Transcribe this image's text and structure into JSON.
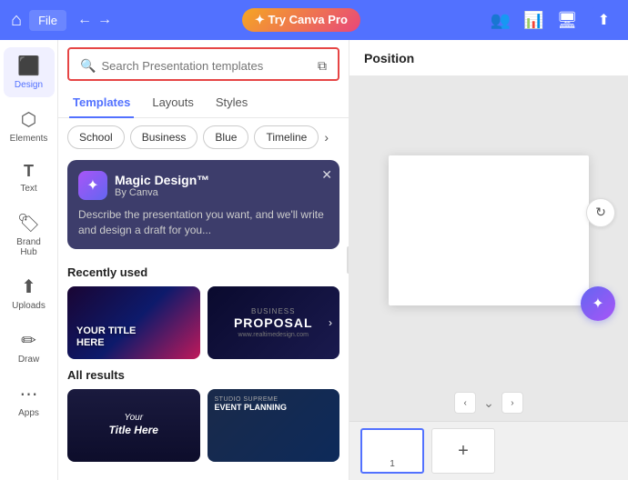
{
  "topbar": {
    "file_label": "File",
    "try_canva_pro_label": "✦ Try Canva Pro",
    "undo_icon": "←",
    "redo_icon": "→",
    "people_icon": "👥",
    "chart_icon": "📊",
    "screen_icon": "🖥",
    "share_icon": "⬆"
  },
  "sidebar": {
    "items": [
      {
        "id": "design",
        "label": "Design",
        "icon": "◻"
      },
      {
        "id": "elements",
        "label": "Elements",
        "icon": "⬡"
      },
      {
        "id": "text",
        "label": "Text",
        "icon": "T"
      },
      {
        "id": "brand",
        "label": "Brand Hub",
        "icon": "🏷"
      },
      {
        "id": "uploads",
        "label": "Uploads",
        "icon": "⬆"
      },
      {
        "id": "draw",
        "label": "Draw",
        "icon": "✏"
      },
      {
        "id": "apps",
        "label": "Apps",
        "icon": "⋯"
      }
    ]
  },
  "panel": {
    "search_placeholder": "Search Presentation templates",
    "tabs": [
      {
        "id": "templates",
        "label": "Templates"
      },
      {
        "id": "layouts",
        "label": "Layouts"
      },
      {
        "id": "styles",
        "label": "Styles"
      }
    ],
    "pills": [
      {
        "label": "School"
      },
      {
        "label": "Business"
      },
      {
        "label": "Blue"
      },
      {
        "label": "Timeline"
      }
    ],
    "magic_design": {
      "title": "Magic Design™",
      "by": "By Canva",
      "description": "Describe the presentation you want, and we'll write and design a draft for you..."
    },
    "recently_used_title": "Recently used",
    "all_results_title": "All results",
    "templates": [
      {
        "id": "your-title",
        "text_line1": "YOUR tITLe",
        "text_line2": "HERE",
        "type": "gradient-dark"
      },
      {
        "id": "business-proposal",
        "top_text": "BUSINESS",
        "main_text": "PROPOSAL",
        "type": "dark-blue"
      },
      {
        "id": "all-result-1",
        "text_line1": "Your",
        "text_line2": "Title Here",
        "type": "italic-dark"
      },
      {
        "id": "all-result-2",
        "tag": "Studio Supreme",
        "title": "EVENT PLANNING",
        "type": "event-planning"
      }
    ]
  },
  "canvas": {
    "position_label": "Position",
    "page_number": "1",
    "add_page_icon": "+",
    "refresh_icon": "↻",
    "magic_icon": "✦"
  }
}
